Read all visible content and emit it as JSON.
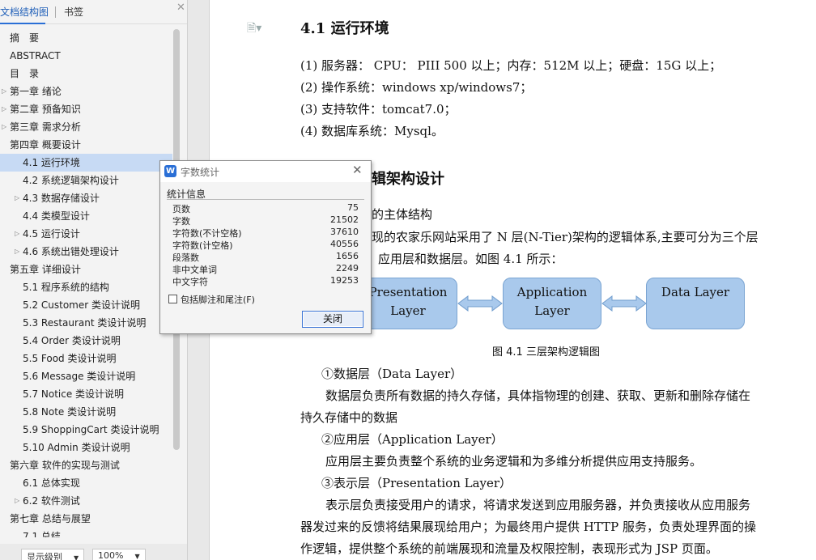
{
  "nav_panel": {
    "tab_outline": "文档结构图",
    "tab_bookmark": "书签",
    "close_glyph": "✕",
    "items": [
      {
        "label": "摘　要",
        "indent": 0,
        "expand": false
      },
      {
        "label": "ABSTRACT",
        "indent": 0,
        "expand": false
      },
      {
        "label": "目　录",
        "indent": 0,
        "expand": false
      },
      {
        "label": "第一章  绪论",
        "indent": 0,
        "expand": true
      },
      {
        "label": "第二章  预备知识",
        "indent": 0,
        "expand": true
      },
      {
        "label": "第三章  需求分析",
        "indent": 0,
        "expand": true
      },
      {
        "label": "第四章  概要设计",
        "indent": 0,
        "expand": false,
        "open": true
      },
      {
        "label": "4.1  运行环境",
        "indent": 1,
        "expand": false,
        "selected": true
      },
      {
        "label": "4.2  系统逻辑架构设计",
        "indent": 1,
        "expand": false
      },
      {
        "label": "4.3  数据存储设计",
        "indent": 1,
        "expand": true
      },
      {
        "label": "4.4  类模型设计",
        "indent": 1,
        "expand": false
      },
      {
        "label": "4.5  运行设计",
        "indent": 1,
        "expand": true
      },
      {
        "label": "4.6  系统出错处理设计",
        "indent": 1,
        "expand": true
      },
      {
        "label": "第五章   详细设计",
        "indent": 0,
        "expand": false,
        "open": true
      },
      {
        "label": "5.1  程序系统的结构",
        "indent": 1,
        "expand": false
      },
      {
        "label": "5.2 Customer 类设计说明",
        "indent": 1,
        "expand": false
      },
      {
        "label": "5.3 Restaurant 类设计说明",
        "indent": 1,
        "expand": false
      },
      {
        "label": "5.4 Order 类设计说明",
        "indent": 1,
        "expand": false
      },
      {
        "label": "5.5 Food 类设计说明",
        "indent": 1,
        "expand": false
      },
      {
        "label": "5.6 Message 类设计说明",
        "indent": 1,
        "expand": false
      },
      {
        "label": "5.7 Notice 类设计说明",
        "indent": 1,
        "expand": false
      },
      {
        "label": "5.8 Note 类设计说明",
        "indent": 1,
        "expand": false
      },
      {
        "label": "5.9 ShoppingCart 类设计说明",
        "indent": 1,
        "expand": false
      },
      {
        "label": "5.10 Admin 类设计说明",
        "indent": 1,
        "expand": false
      },
      {
        "label": "第六章  软件的实现与测试",
        "indent": 0,
        "expand": false,
        "open": true
      },
      {
        "label": "6.1  总体实现",
        "indent": 1,
        "expand": false
      },
      {
        "label": "6.2  软件测试",
        "indent": 1,
        "expand": true
      },
      {
        "label": "第七章  总结与展望",
        "indent": 0,
        "expand": false,
        "open": true
      },
      {
        "label": "7.1  总结",
        "indent": 1,
        "expand": false
      }
    ],
    "level_select": "显示级别",
    "zoom_select": "100%"
  },
  "document": {
    "heading_41": "4.1  运行环境",
    "line1": "(1) 服务器：   CPU：  PIII 500 以上；内存：512M 以上；硬盘：15G 以上；",
    "line2": "(2) 操作系统：windows xp/windows7；",
    "line3": "(3) 支持软件：tomcat7.0；",
    "line4": "(4) 数据库系统：Mysql。",
    "heading_42_fragment": "辑架构设计",
    "sub_fragment": "的主体结构",
    "para_frag1": "现的农家乐网站采用了 N 层(N-Tier)架构的逻辑体系,主要可分为三个层",
    "para_frag2": "应用层和数据层。如图 4.1 所示：",
    "diagram": {
      "box1_line1": "Presentation",
      "box1_line2": "Layer",
      "box2_line1": "Application",
      "box2_line2": "Layer",
      "box3_line1": "Data    Layer"
    },
    "figure_caption": "图 4.1  三层架构逻辑图",
    "item1_title": "①数据层（Data Layer）",
    "item1_body_a": "数据层负责所有数据的持久存储，具体指物理的创建、获取、更新和删除存储在",
    "item1_body_b": "持久存储中的数据",
    "item2_title": "②应用层（Application Layer）",
    "item2_body": "应用层主要负责整个系统的业务逻辑和为多维分析提供应用支持服务。",
    "item3_title": "③表示层（Presentation Layer）",
    "item3_body_a": "表示层负责接受用户的请求，将请求发送到应用服务器，并负责接收从应用服务",
    "item3_body_b": "器发过来的反馈将结果展现给用户；为最终用户提供 HTTP 服务，负责处理界面的操",
    "item3_body_c": "作逻辑，提供整个系统的前端展现和流量及权限控制，表现形式为 JSP 页面。"
  },
  "dialog": {
    "title": "字数统计",
    "logo_letter": "W",
    "close_glyph": "✕",
    "group_label": "统计信息",
    "stats": [
      {
        "key": "页数",
        "value": "75"
      },
      {
        "key": "字数",
        "value": "21502"
      },
      {
        "key": "字符数(不计空格)",
        "value": "37610"
      },
      {
        "key": "字符数(计空格)",
        "value": "40556"
      },
      {
        "key": "段落数",
        "value": "1656"
      },
      {
        "key": "非中文单词",
        "value": "2249"
      },
      {
        "key": "中文字符",
        "value": "19253"
      }
    ],
    "checkbox_label": "包括脚注和尾注(F)",
    "close_button": "关闭"
  },
  "colors": {
    "accent": "#2a6fd6",
    "selected_row": "#c7daf4",
    "diagram_box": "#a9c9ec"
  }
}
